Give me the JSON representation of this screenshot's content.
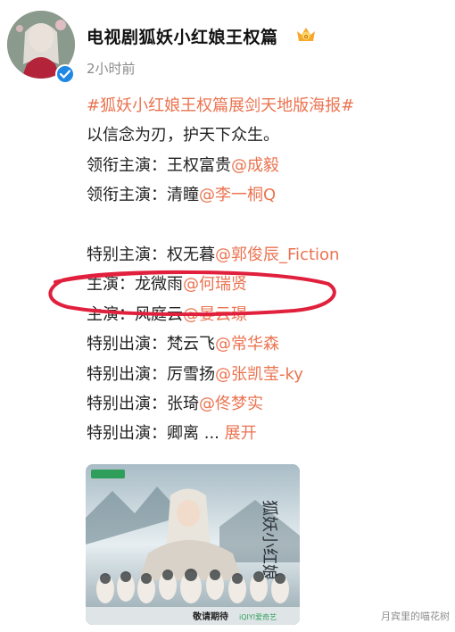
{
  "post": {
    "account_name": "电视剧狐妖小红娘王权篇",
    "time": "2小时前",
    "hashtag": "#狐妖小红娘王权篇展剑天地版海报#",
    "slogan": "以信念为刃，护天下众生。",
    "cast": [
      {
        "role": "领衔主演：王权富贵",
        "mention": "@成毅"
      },
      {
        "role": "领衔主演：清瞳",
        "mention": "@李一桐Q"
      },
      {
        "role": "特别主演：权无暮",
        "mention": "@郭俊辰_Fiction"
      },
      {
        "role": "主演：龙微雨",
        "mention": "@何瑞贤"
      },
      {
        "role": "主演：风庭云",
        "mention": "@晏云璟"
      },
      {
        "role": "特别出演：梵云飞",
        "mention": "@常华森"
      },
      {
        "role": "特别出演：厉雪扬",
        "mention": "@张凯莹-ky"
      },
      {
        "role": "特别出演：张琦",
        "mention": "@佟梦实"
      }
    ],
    "last_line": "特别出演：卿离",
    "ellipsis": "...",
    "expand_label": "展开"
  },
  "poster": {
    "title_calligraphy": "狐妖小红娘",
    "subtitle": "王权篇",
    "promo_text": "敬请期待",
    "platform": "iQIYI爱奇艺"
  },
  "watermark": "月宾里的喵花树",
  "colors": {
    "link": "#eb7350",
    "verified": "#1f88e5",
    "highlight": "#e0203c"
  }
}
